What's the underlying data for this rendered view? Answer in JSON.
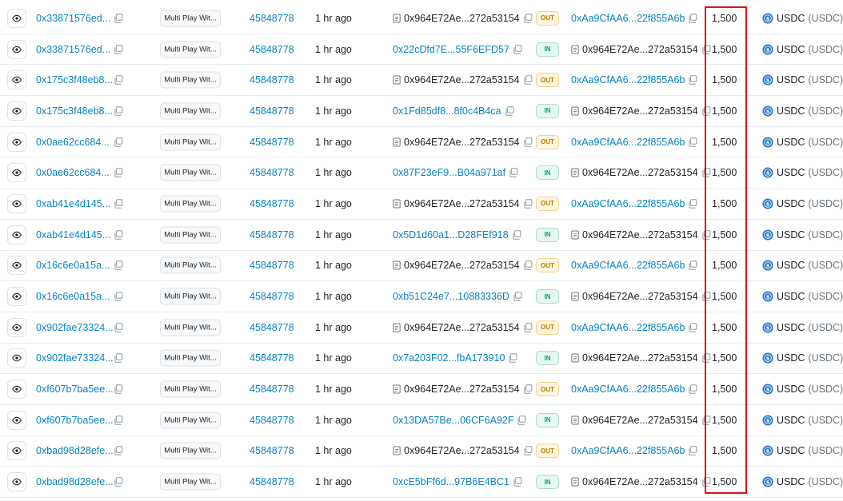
{
  "colors": {
    "link": "#0784c3",
    "out": "#b47d00",
    "in": "#00a186",
    "highlight": "#d9111c",
    "usdc": "#2775ca"
  },
  "icons": {
    "view": "eye-icon",
    "copy": "copy-icon",
    "contract": "document-icon",
    "token": "usdc-coin-icon"
  },
  "rows": [
    {
      "tx": "0x33871576ed...",
      "method": "Multi Play Wit...",
      "block": "45848778",
      "age": "1 hr ago",
      "from": "0x964E72Ae...272a53154",
      "from_contract": true,
      "dir": "OUT",
      "to": "0xAa9CfAA6...22f855A6b",
      "to_contract": false,
      "amount": "1,500",
      "token": "USDC",
      "token_sym": "(USDC)"
    },
    {
      "tx": "0x33871576ed...",
      "method": "Multi Play Wit...",
      "block": "45848778",
      "age": "1 hr ago",
      "from": "0x22cDfd7E...55F6EFD57",
      "from_contract": false,
      "dir": "IN",
      "to": "0x964E72Ae...272a53154",
      "to_contract": true,
      "amount": "1,500",
      "token": "USDC",
      "token_sym": "(USDC)"
    },
    {
      "tx": "0x175c3f48eb8...",
      "method": "Multi Play Wit...",
      "block": "45848778",
      "age": "1 hr ago",
      "from": "0x964E72Ae...272a53154",
      "from_contract": true,
      "dir": "OUT",
      "to": "0xAa9CfAA6...22f855A6b",
      "to_contract": false,
      "amount": "1,500",
      "token": "USDC",
      "token_sym": "(USDC)"
    },
    {
      "tx": "0x175c3f48eb8...",
      "method": "Multi Play Wit...",
      "block": "45848778",
      "age": "1 hr ago",
      "from": "0x1Fd85df8...8f0c4B4ca",
      "from_contract": false,
      "dir": "IN",
      "to": "0x964E72Ae...272a53154",
      "to_contract": true,
      "amount": "1,500",
      "token": "USDC",
      "token_sym": "(USDC)"
    },
    {
      "tx": "0x0ae62cc684...",
      "method": "Multi Play Wit...",
      "block": "45848778",
      "age": "1 hr ago",
      "from": "0x964E72Ae...272a53154",
      "from_contract": true,
      "dir": "OUT",
      "to": "0xAa9CfAA6...22f855A6b",
      "to_contract": false,
      "amount": "1,500",
      "token": "USDC",
      "token_sym": "(USDC)"
    },
    {
      "tx": "0x0ae62cc684...",
      "method": "Multi Play Wit...",
      "block": "45848778",
      "age": "1 hr ago",
      "from": "0x87F23eF9...B04a971af",
      "from_contract": false,
      "dir": "IN",
      "to": "0x964E72Ae...272a53154",
      "to_contract": true,
      "amount": "1,500",
      "token": "USDC",
      "token_sym": "(USDC)"
    },
    {
      "tx": "0xab41e4d145...",
      "method": "Multi Play Wit...",
      "block": "45848778",
      "age": "1 hr ago",
      "from": "0x964E72Ae...272a53154",
      "from_contract": true,
      "dir": "OUT",
      "to": "0xAa9CfAA6...22f855A6b",
      "to_contract": false,
      "amount": "1,500",
      "token": "USDC",
      "token_sym": "(USDC)"
    },
    {
      "tx": "0xab41e4d145...",
      "method": "Multi Play Wit...",
      "block": "45848778",
      "age": "1 hr ago",
      "from": "0x5D1d60a1...D28FEf918",
      "from_contract": false,
      "dir": "IN",
      "to": "0x964E72Ae...272a53154",
      "to_contract": true,
      "amount": "1,500",
      "token": "USDC",
      "token_sym": "(USDC)"
    },
    {
      "tx": "0x16c6e0a15a...",
      "method": "Multi Play Wit...",
      "block": "45848778",
      "age": "1 hr ago",
      "from": "0x964E72Ae...272a53154",
      "from_contract": true,
      "dir": "OUT",
      "to": "0xAa9CfAA6...22f855A6b",
      "to_contract": false,
      "amount": "1,500",
      "token": "USDC",
      "token_sym": "(USDC)"
    },
    {
      "tx": "0x16c6e0a15a...",
      "method": "Multi Play Wit...",
      "block": "45848778",
      "age": "1 hr ago",
      "from": "0xb51C24e7...10883336D",
      "from_contract": false,
      "dir": "IN",
      "to": "0x964E72Ae...272a53154",
      "to_contract": true,
      "amount": "1,500",
      "token": "USDC",
      "token_sym": "(USDC)"
    },
    {
      "tx": "0x902fae73324...",
      "method": "Multi Play Wit...",
      "block": "45848778",
      "age": "1 hr ago",
      "from": "0x964E72Ae...272a53154",
      "from_contract": true,
      "dir": "OUT",
      "to": "0xAa9CfAA6...22f855A6b",
      "to_contract": false,
      "amount": "1,500",
      "token": "USDC",
      "token_sym": "(USDC)"
    },
    {
      "tx": "0x902fae73324...",
      "method": "Multi Play Wit...",
      "block": "45848778",
      "age": "1 hr ago",
      "from": "0x7a203F02...fbA173910",
      "from_contract": false,
      "dir": "IN",
      "to": "0x964E72Ae...272a53154",
      "to_contract": true,
      "amount": "1,500",
      "token": "USDC",
      "token_sym": "(USDC)"
    },
    {
      "tx": "0xf607b7ba5ee...",
      "method": "Multi Play Wit...",
      "block": "45848778",
      "age": "1 hr ago",
      "from": "0x964E72Ae...272a53154",
      "from_contract": true,
      "dir": "OUT",
      "to": "0xAa9CfAA6...22f855A6b",
      "to_contract": false,
      "amount": "1,500",
      "token": "USDC",
      "token_sym": "(USDC)"
    },
    {
      "tx": "0xf607b7ba5ee...",
      "method": "Multi Play Wit...",
      "block": "45848778",
      "age": "1 hr ago",
      "from": "0x13DA57Be...06CF6A92F",
      "from_contract": false,
      "dir": "IN",
      "to": "0x964E72Ae...272a53154",
      "to_contract": true,
      "amount": "1,500",
      "token": "USDC",
      "token_sym": "(USDC)"
    },
    {
      "tx": "0xbad98d28efe...",
      "method": "Multi Play Wit...",
      "block": "45848778",
      "age": "1 hr ago",
      "from": "0x964E72Ae...272a53154",
      "from_contract": true,
      "dir": "OUT",
      "to": "0xAa9CfAA6...22f855A6b",
      "to_contract": false,
      "amount": "1,500",
      "token": "USDC",
      "token_sym": "(USDC)"
    },
    {
      "tx": "0xbad98d28efe...",
      "method": "Multi Play Wit...",
      "block": "45848778",
      "age": "1 hr ago",
      "from": "0xcE5bFf6d...97B6E4BC1",
      "from_contract": false,
      "dir": "IN",
      "to": "0x964E72Ae...272a53154",
      "to_contract": true,
      "amount": "1,500",
      "token": "USDC",
      "token_sym": "(USDC)"
    }
  ]
}
